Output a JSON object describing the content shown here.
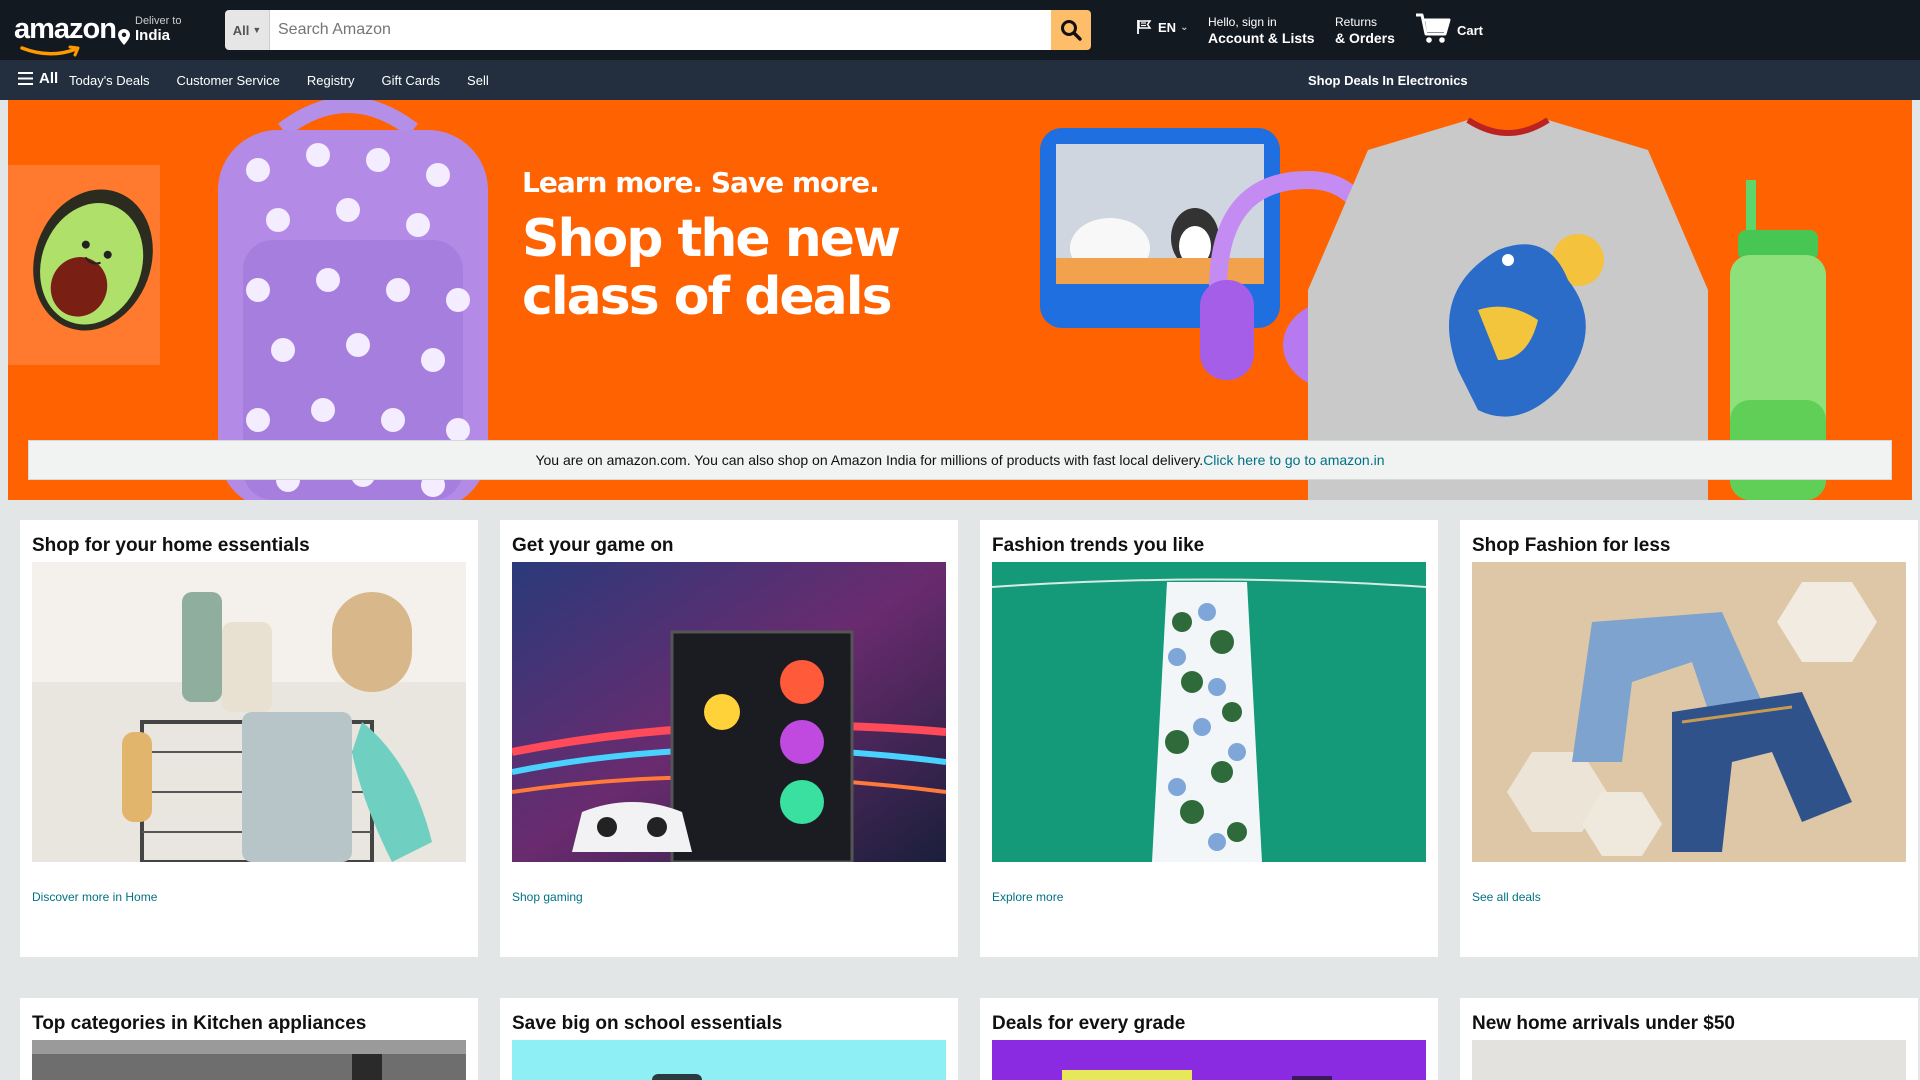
{
  "header": {
    "logo": "amazon",
    "deliver_line1": "Deliver to",
    "deliver_line2": "India",
    "search_category": "All",
    "search_placeholder": "Search Amazon",
    "language": "EN",
    "account_line1": "Hello, sign in",
    "account_line2": "Account & Lists",
    "returns_line1": "Returns",
    "returns_line2": "& Orders",
    "cart_label": "Cart"
  },
  "subnav": {
    "all_label": "All",
    "links": [
      "Today's Deals",
      "Customer Service",
      "Registry",
      "Gift Cards",
      "Sell"
    ],
    "promo": "Shop Deals In Electronics"
  },
  "hero": {
    "line1": "Learn more. Save more.",
    "line2": "Shop the new class of deals"
  },
  "notice": {
    "text": "You are on amazon.com. You can also shop on Amazon India for millions of products with fast local delivery.",
    "link": "Click here to go to amazon.in"
  },
  "cards": [
    {
      "title": "Shop for your home essentials",
      "link": "Discover more in Home"
    },
    {
      "title": "Get your game on",
      "link": "Shop gaming"
    },
    {
      "title": "Fashion trends you like",
      "link": "Explore more"
    },
    {
      "title": "Shop Fashion for less",
      "link": "See all deals"
    }
  ],
  "cards_row2": [
    {
      "title": "Top categories in Kitchen appliances"
    },
    {
      "title": "Save big on school essentials"
    },
    {
      "title": "Deals for every grade"
    },
    {
      "title": "New home arrivals under $50"
    }
  ],
  "colors": {
    "nav_dark": "#131921",
    "nav_sub": "#232f3e",
    "search_button": "#febd69",
    "hero_orange": "#ff6200",
    "link": "#007185"
  }
}
